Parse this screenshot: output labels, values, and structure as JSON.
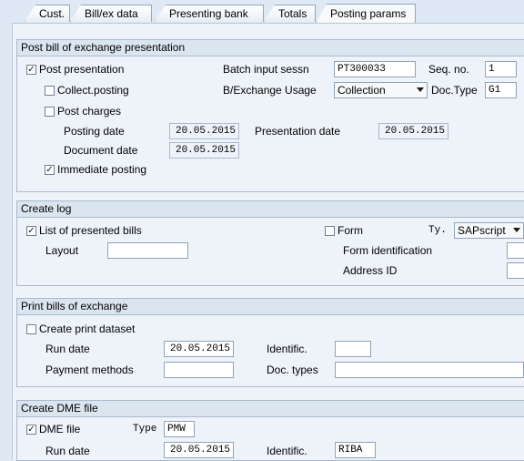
{
  "tabs": [
    "Cust.",
    "Bill/ex data",
    "Presenting bank",
    "Totals",
    "Posting params"
  ],
  "post": {
    "title": "Post bill of exchange presentation",
    "post_presentation": "Post presentation",
    "post_presentation_checked": true,
    "batch_label": "Batch input sessn",
    "batch_value": "PT300033",
    "seq_label": "Seq. no.",
    "seq_value": "1",
    "collect_posting": "Collect.posting",
    "collect_posting_checked": false,
    "usage_label": "B/Exchange Usage",
    "usage_value": "Collection",
    "doctype_label": "Doc.Type",
    "doctype_value": "G1",
    "post_charges": "Post charges",
    "post_charges_checked": false,
    "posting_date_label": "Posting date",
    "posting_date_value": "20.05.2015",
    "presentation_date_label": "Presentation date",
    "presentation_date_value": "20.05.2015",
    "document_date_label": "Document date",
    "document_date_value": "20.05.2015",
    "immediate_posting": "Immediate posting",
    "immediate_posting_checked": true
  },
  "log": {
    "title": "Create log",
    "list_bills": "List of presented bills",
    "list_bills_checked": true,
    "form_label": "Form",
    "form_checked": false,
    "ty_label": "Ty.",
    "ty_value": "SAPscript",
    "layout_label": "Layout",
    "layout_value": "",
    "form_id_label": "Form identification",
    "address_id_label": "Address ID"
  },
  "print": {
    "title": "Print bills of exchange",
    "create_dataset": "Create print dataset",
    "create_dataset_checked": false,
    "run_date_label": "Run date",
    "run_date_value": "20.05.2015",
    "identific_label": "Identific.",
    "identific_value": "",
    "payment_methods_label": "Payment methods",
    "payment_methods_value": "",
    "doc_types_label": "Doc. types",
    "doc_types_value": ""
  },
  "dme": {
    "title": "Create DME file",
    "dme_file": "DME file",
    "dme_file_checked": true,
    "type_label": "Type",
    "type_value": "PMW",
    "run_date_label": "Run date",
    "run_date_value": "20.05.2015",
    "identific_label": "Identific.",
    "identific_value": "RIBA"
  },
  "colors": {
    "background": "#dfe9f5",
    "panel": "#eef3f9",
    "group_header": "#dbe5f0",
    "border": "#a9b9cc"
  },
  "icons": {
    "checkbox_checked": "check-mark",
    "dropdown": "chevron-down-icon"
  }
}
